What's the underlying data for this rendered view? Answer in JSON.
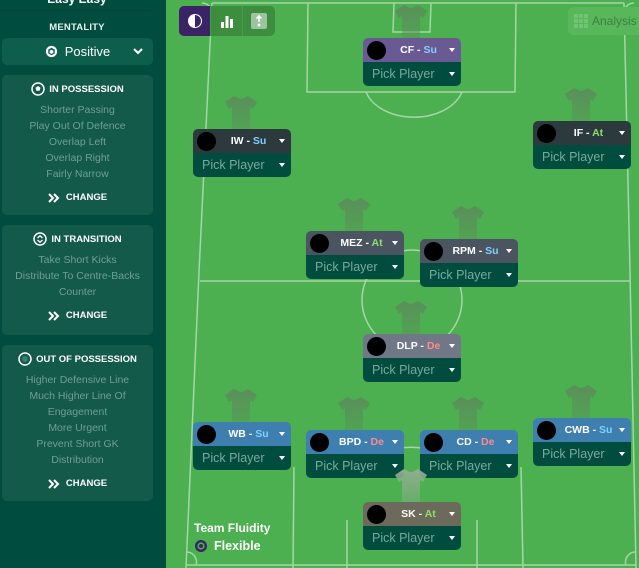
{
  "sidebar": {
    "title": "Easy Easy",
    "mentality_label": "MENTALITY",
    "mentality_value": "Positive",
    "panels": [
      {
        "title": "IN POSSESSION",
        "icon": "ball-icon",
        "items": [
          "Shorter Passing",
          "Play Out Of Defence",
          "Overlap Left",
          "Overlap Right",
          "Fairly Narrow"
        ],
        "change_label": "CHANGE"
      },
      {
        "title": "IN TRANSITION",
        "icon": "transition-icon",
        "items": [
          "Take Short Kicks",
          "Distribute To Centre-Backs",
          "Counter"
        ],
        "change_label": "CHANGE"
      },
      {
        "title": "OUT OF POSSESSION",
        "icon": "ball-outline-icon",
        "items": [
          "Higher Defensive Line",
          "Much Higher Line Of",
          "Engagement",
          "More Urgent",
          "Prevent Short GK",
          "Distribution"
        ],
        "change_label": "CHANGE"
      }
    ]
  },
  "toolbar": {
    "buttons": [
      {
        "icon": "contrast-icon",
        "active": true
      },
      {
        "icon": "bar-chart-icon",
        "active": false
      },
      {
        "icon": "instruction-icon",
        "active": false
      }
    ],
    "analysis_label": "Analysis"
  },
  "positions": [
    {
      "role": "CF",
      "duty": "Su",
      "player": "Pick Player"
    },
    {
      "role": "IW",
      "duty": "Su",
      "player": "Pick Player"
    },
    {
      "role": "IF",
      "duty": "At",
      "player": "Pick Player"
    },
    {
      "role": "MEZ",
      "duty": "At",
      "player": "Pick Player"
    },
    {
      "role": "RPM",
      "duty": "Su",
      "player": "Pick Player"
    },
    {
      "role": "DLP",
      "duty": "De",
      "player": "Pick Player"
    },
    {
      "role": "WB",
      "duty": "Su",
      "player": "Pick Player"
    },
    {
      "role": "BPD",
      "duty": "De",
      "player": "Pick Player"
    },
    {
      "role": "CD",
      "duty": "De",
      "player": "Pick Player"
    },
    {
      "role": "CWB",
      "duty": "Su",
      "player": "Pick Player"
    },
    {
      "role": "SK",
      "duty": "At",
      "player": "Pick Player"
    }
  ],
  "role_separator": " - ",
  "team_fluidity": {
    "label": "Team Fluidity",
    "value": "Flexible"
  },
  "colors": {
    "sidebar_bg": "#004d40",
    "pitch": "#4caf50",
    "support_duty": "#7fd0ff",
    "attack_duty": "#8ee06a",
    "defend_duty": "#ff8a8a",
    "active_tool": "#3b2466"
  }
}
